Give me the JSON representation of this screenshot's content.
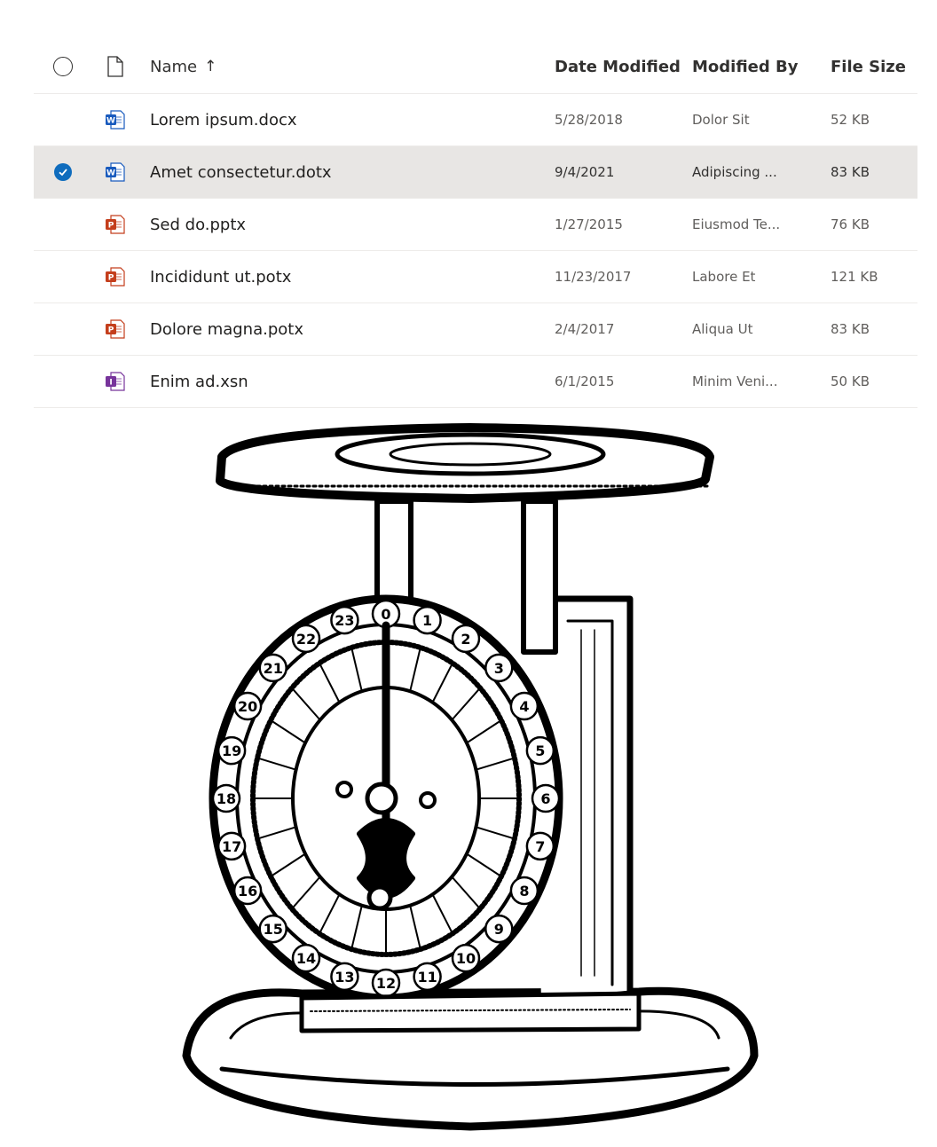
{
  "header": {
    "name_label": "Name",
    "sort_arrow": "↑",
    "date_label": "Date Modified",
    "modified_by_label": "Modified By",
    "size_label": "File Size"
  },
  "files": [
    {
      "name": "Lorem ipsum.docx",
      "date": "5/28/2018",
      "by": "Dolor Sit",
      "size": "52 KB",
      "type": "word-icon",
      "selected": false
    },
    {
      "name": "Amet consectetur.dotx",
      "date": "9/4/2021",
      "by": "Adipiscing ...",
      "size": "83 KB",
      "type": "word-icon",
      "selected": true
    },
    {
      "name": "Sed do.pptx",
      "date": "1/27/2015",
      "by": "Eiusmod Te...",
      "size": "76 KB",
      "type": "powerpoint-icon",
      "selected": false
    },
    {
      "name": "Incididunt ut.potx",
      "date": "11/23/2017",
      "by": "Labore Et",
      "size": "121 KB",
      "type": "powerpoint-icon",
      "selected": false
    },
    {
      "name": "Dolore magna.potx",
      "date": "2/4/2017",
      "by": "Aliqua Ut",
      "size": "83 KB",
      "type": "powerpoint-icon",
      "selected": false
    },
    {
      "name": "Enim ad.xsn",
      "date": "6/1/2015",
      "by": "Minim Veni...",
      "size": "50 KB",
      "type": "infopath-icon",
      "selected": false
    }
  ],
  "colors": {
    "word": "#185abd",
    "powerpoint": "#c43e1c",
    "infopath": "#77349b",
    "selected_check": "#0f6cbd"
  },
  "illustration": {
    "subject": "vintage kitchen scale engraving",
    "dial_numbers": [
      "0",
      "1",
      "2",
      "3",
      "4",
      "5",
      "6",
      "7",
      "8",
      "9",
      "10",
      "11",
      "12",
      "13",
      "14",
      "15",
      "16",
      "17",
      "18",
      "19",
      "20",
      "21",
      "22",
      "23"
    ]
  }
}
